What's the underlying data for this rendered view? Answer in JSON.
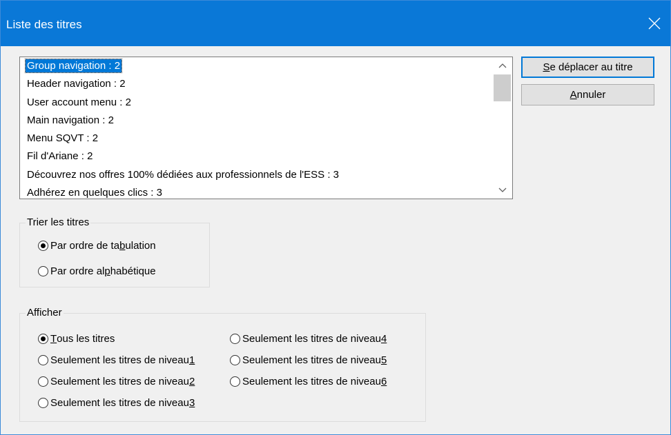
{
  "window": {
    "title": "Liste des titres"
  },
  "headings": {
    "items": [
      "Group navigation : 2",
      "Header navigation : 2",
      "User account menu : 2",
      "Main navigation : 2",
      "Menu SQVT : 2",
      "Fil d'Ariane : 2",
      "Découvrez nos offres 100% dédiées aux professionnels de l'ESS : 3",
      "Adhérez en quelques clics : 3"
    ],
    "selected_index": 0
  },
  "buttons": {
    "move": {
      "pre": "",
      "key": "S",
      "post": "e déplacer au titre"
    },
    "cancel": {
      "pre": "",
      "key": "A",
      "post": "nnuler"
    }
  },
  "sort": {
    "legend": "Trier les titres",
    "options": [
      {
        "pre": "Par ordre de ta",
        "key": "b",
        "post": "ulation",
        "checked": true
      },
      {
        "pre": "Par ordre al",
        "key": "p",
        "post": "habétique",
        "checked": false
      }
    ]
  },
  "show": {
    "legend": "Afficher",
    "options": [
      {
        "pre": "",
        "key": "T",
        "post": "ous les titres",
        "checked": true
      },
      {
        "pre": "Seulement les titres de niveau ",
        "key": "1",
        "post": "",
        "checked": false
      },
      {
        "pre": "Seulement les titres de niveau ",
        "key": "2",
        "post": "",
        "checked": false
      },
      {
        "pre": "Seulement les titres de niveau ",
        "key": "3",
        "post": "",
        "checked": false
      },
      {
        "pre": "Seulement les titres de niveau ",
        "key": "4",
        "post": "",
        "checked": false
      },
      {
        "pre": "Seulement les titres de niveau ",
        "key": "5",
        "post": "",
        "checked": false
      },
      {
        "pre": "Seulement les titres de niveau ",
        "key": "6",
        "post": "",
        "checked": false
      }
    ]
  },
  "icons": {
    "close": "close-icon",
    "scroll_up": "chevron-up-icon",
    "scroll_down": "chevron-down-icon"
  },
  "colors": {
    "titlebar": "#0a78d7",
    "selection": "#0078d7",
    "background": "#f0f0f0"
  }
}
